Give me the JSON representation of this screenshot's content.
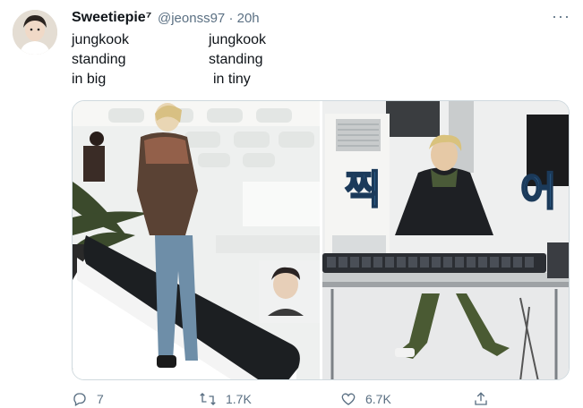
{
  "tweet": {
    "display_name": "Sweetiepie⁷",
    "handle_time": "@jeonss97 · 20h",
    "more_icon": "more-horizontal-icon",
    "lines_left": [
      "jungkook",
      "standing",
      "in big"
    ],
    "lines_right": [
      "jungkook",
      "standing",
      "in tiny"
    ],
    "media": {
      "left_image": "photo-person-standing-big-escalator",
      "right_image": "photo-person-standing-tiny-keyboard",
      "right_caption_left": "찍",
      "right_caption_right": "어"
    },
    "actions": {
      "reply_count": "7",
      "retweet_count": "1.7K",
      "like_count": "6.7K",
      "reply_icon": "reply-icon",
      "retweet_icon": "retweet-icon",
      "like_icon": "heart-icon",
      "share_icon": "share-icon"
    }
  },
  "colors": {
    "secondary_text": "#5b7083",
    "caption_blue": "#4fa8e8"
  }
}
